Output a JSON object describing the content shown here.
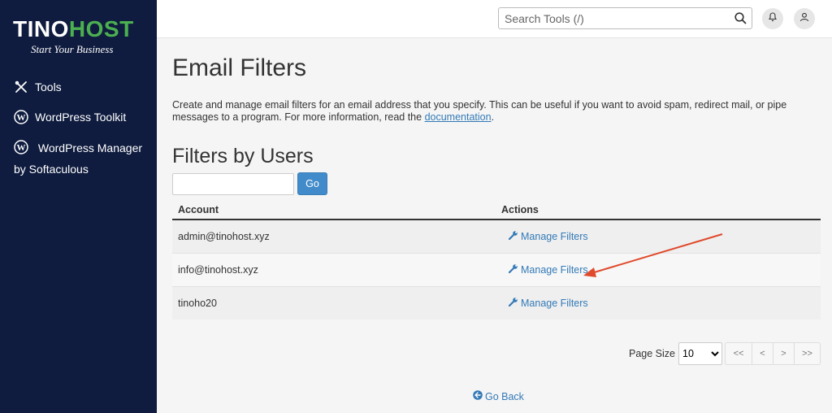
{
  "brand": {
    "name_part1": "TINO",
    "name_part2": "HOST",
    "tagline": "Start Your Business",
    "colors": {
      "sidebar_bg": "#0f1c3f",
      "accent_green": "#4caf50",
      "link_blue": "#337ab7",
      "button_blue": "#428bca"
    }
  },
  "sidebar": {
    "items": [
      {
        "label": "Tools",
        "icon": "tools-icon"
      },
      {
        "label": "WordPress Toolkit",
        "icon": "wordpress-icon"
      },
      {
        "label": "WordPress Manager by Softaculous",
        "icon": "wordpress-icon"
      }
    ]
  },
  "topbar": {
    "search_placeholder": "Search Tools (/)",
    "icons": [
      "search-icon",
      "bell-icon",
      "user-icon"
    ]
  },
  "main": {
    "title": "Email Filters",
    "description_text": "Create and manage email filters for an email address that you specify. This can be useful if you want to avoid spam, redirect mail, or pipe messages to a program. For more information, read the ",
    "description_link": "documentation",
    "description_end": ".",
    "section_title": "Filters by Users",
    "filter_input_value": "",
    "go_label": "Go",
    "table": {
      "headers": [
        "Account",
        "Actions"
      ],
      "rows": [
        {
          "account": "admin@tinohost.xyz",
          "action": "Manage Filters"
        },
        {
          "account": "info@tinohost.xyz",
          "action": "Manage Filters"
        },
        {
          "account": "tinoho20",
          "action": "Manage Filters"
        }
      ]
    },
    "pagination": {
      "page_size_label": "Page Size",
      "page_size_value": "10",
      "page_size_options": [
        "10"
      ],
      "buttons": [
        "<<",
        "<",
        ">",
        ">>"
      ]
    },
    "go_back_label": "Go Back"
  },
  "annotation": {
    "arrow_color": "#e0492c"
  }
}
